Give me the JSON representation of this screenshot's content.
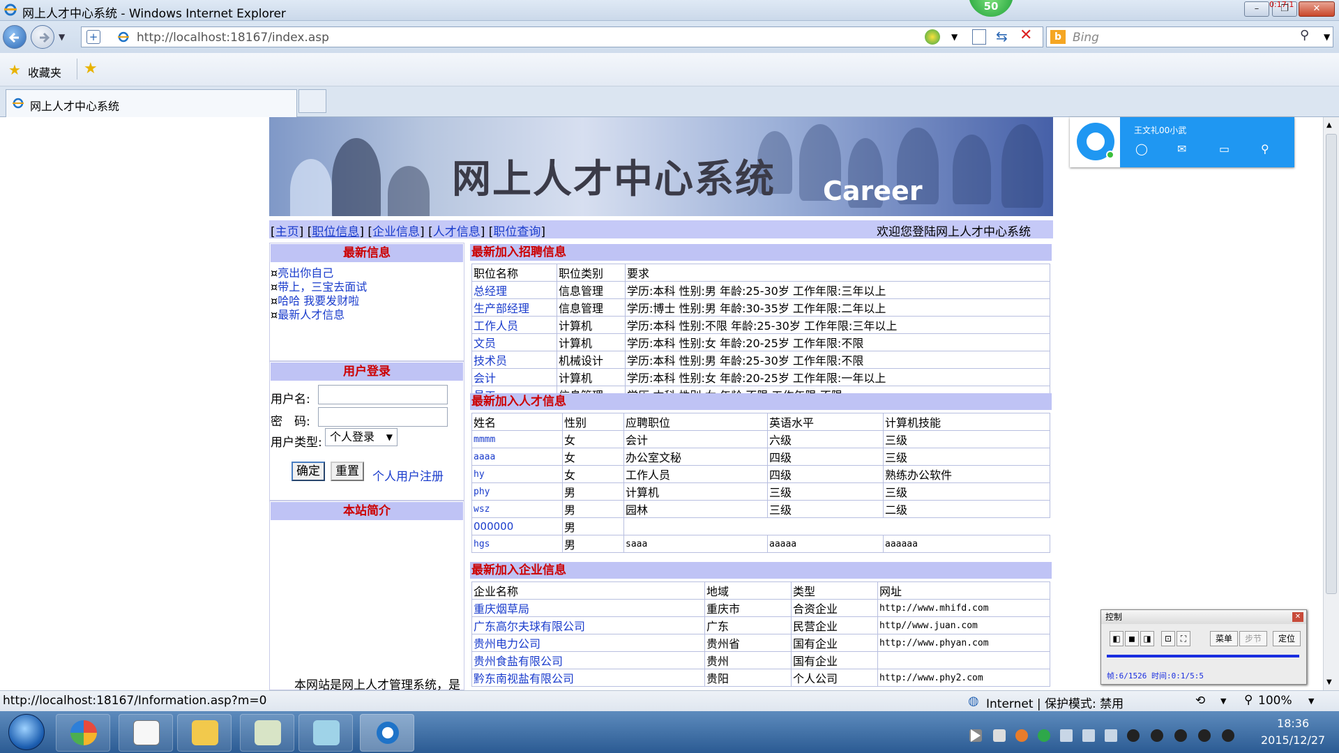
{
  "window": {
    "title": "网上人才中心系统 - Windows Internet Explorer",
    "badge": "50",
    "corner_time": "0:17:1"
  },
  "browser": {
    "address": "http://localhost:18167/index.asp",
    "search_placeholder": "Bing",
    "favorites_label": "收藏夹",
    "tab_title": "网上人才中心系统"
  },
  "banner": {
    "title": "网上人才中心系统",
    "subtitle": "Career"
  },
  "nav": {
    "items": [
      "主页",
      "职位信息",
      "企业信息",
      "人才信息",
      "职位查询"
    ],
    "welcome": "欢迎您登陆网上人才中心系统"
  },
  "sidebar": {
    "news_title": "最新信息",
    "news": [
      {
        "marker": "¤",
        "text": "亮出你自己"
      },
      {
        "marker": "¤",
        "text": "带上，三宝去面试"
      },
      {
        "marker": "¤",
        "text": "哈哈  我要发财啦"
      },
      {
        "marker": "¤",
        "text": "最新人才信息"
      }
    ],
    "login": {
      "title": "用户登录",
      "username_label": "用户名:",
      "password_label": "密　码:",
      "usertype_label": "用户类型:",
      "usertype_value": "个人登录",
      "confirm": "确定",
      "reset": "重置",
      "register": "个人用户注册"
    },
    "intro_title": "本站简介",
    "intro_text": "本网站是网上人才管理系统，是"
  },
  "jobs": {
    "title": "最新加入招聘信息",
    "headers": [
      "职位名称",
      "职位类别",
      "要求"
    ],
    "rows": [
      [
        "总经理",
        "信息管理",
        "学历:本科  性别:男 年龄:25-30岁 工作年限:三年以上"
      ],
      [
        "生产部经理",
        "信息管理",
        "学历:博士  性别:男 年龄:30-35岁 工作年限:二年以上"
      ],
      [
        "工作人员",
        "计算机",
        "学历:本科  性别:不限 年龄:25-30岁 工作年限:三年以上"
      ],
      [
        "文员",
        "计算机",
        "学历:本科  性别:女 年龄:20-25岁 工作年限:不限"
      ],
      [
        "技术员",
        "机械设计",
        "学历:本科  性别:男 年龄:25-30岁 工作年限:不限"
      ],
      [
        "会计",
        "计算机",
        "学历:本科  性别:女 年龄:20-25岁 工作年限:一年以上"
      ],
      [
        "员工",
        "信息管理",
        "学历:本科  性别:女 年龄:不限 工作年限:不限"
      ]
    ]
  },
  "talents": {
    "title": "最新加入人才信息",
    "headers": [
      "姓名",
      "性别",
      "应聘职位",
      "英语水平",
      "计算机技能"
    ],
    "rows": [
      [
        "mmmm",
        "女",
        "会计",
        "六级",
        "三级"
      ],
      [
        "aaaa",
        "女",
        "办公室文秘",
        "四级",
        "三级"
      ],
      [
        "hy",
        "女",
        "工作人员",
        "四级",
        "熟练办公软件"
      ],
      [
        "phy",
        "男",
        "计算机",
        "三级",
        "三级"
      ],
      [
        "wsz",
        "男",
        "园林",
        "三级",
        "二级"
      ],
      [
        "000000",
        "男",
        "",
        "",
        ""
      ],
      [
        "hgs",
        "男",
        "saaa",
        "aaaaa",
        "aaaaaa"
      ]
    ]
  },
  "companies": {
    "title": "最新加入企业信息",
    "headers": [
      "企业名称",
      "地域",
      "类型",
      "网址"
    ],
    "rows": [
      [
        "重庆烟草局",
        "重庆市",
        "合资企业",
        "http://www.mhifd.com"
      ],
      [
        "广东高尔夫球有限公司",
        "广东",
        "民营企业",
        "http//www.juan.com"
      ],
      [
        "贵州电力公司",
        "贵州省",
        "国有企业",
        "http://www.phyan.com"
      ],
      [
        "贵州食盐有限公司",
        "贵州",
        "国有企业",
        ""
      ],
      [
        "黔东南视盐有限公司",
        "贵阳",
        "个人公司",
        "http://www.phy2.com"
      ]
    ]
  },
  "widget": {
    "user": "王文礼00小武"
  },
  "control": {
    "title": "控制",
    "menu": "菜单",
    "step": "步节",
    "locate": "定位",
    "status": "帧:6/1526 时间:0:1/5:5"
  },
  "status": {
    "url": "http://localhost:18167/Information.asp?m=0",
    "zone": "Internet | 保护模式: 禁用",
    "zoom": "100%"
  },
  "taskbar": {
    "time": "18:36",
    "date": "2015/12/27"
  },
  "colors": {
    "header_bg": "#bfc3f5",
    "header_text": "#cc0000",
    "link": "#1a3ccc"
  }
}
